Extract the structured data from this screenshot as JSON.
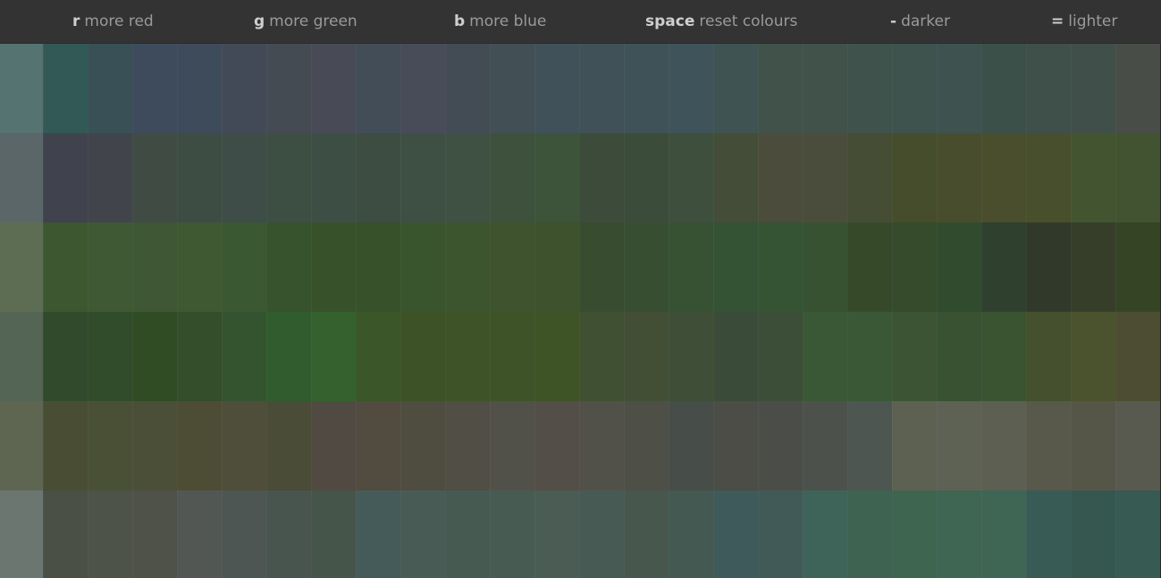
{
  "toolbar": {
    "hints": [
      {
        "key": "r",
        "label": "more red"
      },
      {
        "key": "g",
        "label": "more green"
      },
      {
        "key": "b",
        "label": "more blue"
      },
      {
        "key": "space",
        "label": "reset colours"
      },
      {
        "key": "-",
        "label": "darker"
      },
      {
        "key": "=",
        "label": "lighter"
      }
    ]
  },
  "palette": {
    "rows": [
      {
        "swatch": "#557471",
        "cells": [
          "#325956",
          "#385056",
          "#3d4b5c",
          "#3e4b5b",
          "#434a57",
          "#454b53",
          "#484b55",
          "#434d58",
          "#484c58",
          "#434c55",
          "#424f55",
          "#415159",
          "#405157",
          "#3f5258",
          "#3f535a",
          "#3f5452",
          "#405249",
          "#405249",
          "#3f524c",
          "#3e524e",
          "#3e5350",
          "#3b5049",
          "#3f4f4a",
          "#404f4a",
          "#484d48"
        ]
      },
      {
        "swatch": "#5b6668",
        "cells": [
          "#40424d",
          "#42444c",
          "#3f4b43",
          "#3d4d44",
          "#3e4d47",
          "#3d4e43",
          "#3d4f45",
          "#3e4d42",
          "#3e5044",
          "#3e5142",
          "#3e513d",
          "#3d533a",
          "#3d4c3a",
          "#3c4c3a",
          "#3e4f3d",
          "#444d37",
          "#4b4c3b",
          "#4a4d3c",
          "#454d35",
          "#464d2c",
          "#484d2e",
          "#4a4e2d",
          "#474f2c",
          "#435430",
          "#415330"
        ]
      },
      {
        "swatch": "#5c6d53",
        "cells": [
          "#3d5730",
          "#3f5934",
          "#3f5735",
          "#3f5932",
          "#3a5831",
          "#36532d",
          "#37522b",
          "#37522b",
          "#39552d",
          "#3c552e",
          "#3e532e",
          "#3e522e",
          "#384d30",
          "#384e31",
          "#375233",
          "#335334",
          "#345434",
          "#375230",
          "#364a2a",
          "#354b2c",
          "#314b2f",
          "#30402f",
          "#313a2a",
          "#363e2a",
          "#364426"
        ]
      },
      {
        "swatch": "#556555",
        "cells": [
          "#304a2b",
          "#314c2a",
          "#304c25",
          "#344d2a",
          "#345430",
          "#315c2d",
          "#34612e",
          "#3b5628",
          "#3d5327",
          "#3e5328",
          "#3e5428",
          "#3e5427",
          "#405032",
          "#424f35",
          "#3f4e36",
          "#3b4b3a",
          "#3c4e37",
          "#3a5835",
          "#3a5835",
          "#3c5433",
          "#395232",
          "#3a5432",
          "#44502e",
          "#4a532d",
          "#4c4d32"
        ]
      },
      {
        "swatch": "#5e6651",
        "cells": [
          "#484d34",
          "#4a5036",
          "#4b4f37",
          "#4d4d36",
          "#4f4e3a",
          "#4a4c37",
          "#514a42",
          "#524b40",
          "#4f4c40",
          "#504e45",
          "#51514a",
          "#534e47",
          "#51514a",
          "#4e5047",
          "#474d48",
          "#4b4d46",
          "#4b4e48",
          "#4d514c",
          "#4e5651",
          "#5c6152",
          "#5e6254",
          "#5c5f51",
          "#58584b",
          "#555648",
          "#585a4f"
        ]
      },
      {
        "swatch": "#6b7671",
        "cells": [
          "#4a5046",
          "#4e5349",
          "#4f5249",
          "#525753",
          "#4d5652",
          "#48554e",
          "#465549",
          "#455b59",
          "#495b55",
          "#475a52",
          "#485b53",
          "#4a5c53",
          "#475b54",
          "#47574e",
          "#435952",
          "#3f5a5a",
          "#415a57",
          "#3e645a",
          "#3e6350",
          "#3e6550",
          "#3e6653",
          "#3f6554",
          "#385c55",
          "#36574f",
          "#375a52"
        ]
      }
    ]
  }
}
